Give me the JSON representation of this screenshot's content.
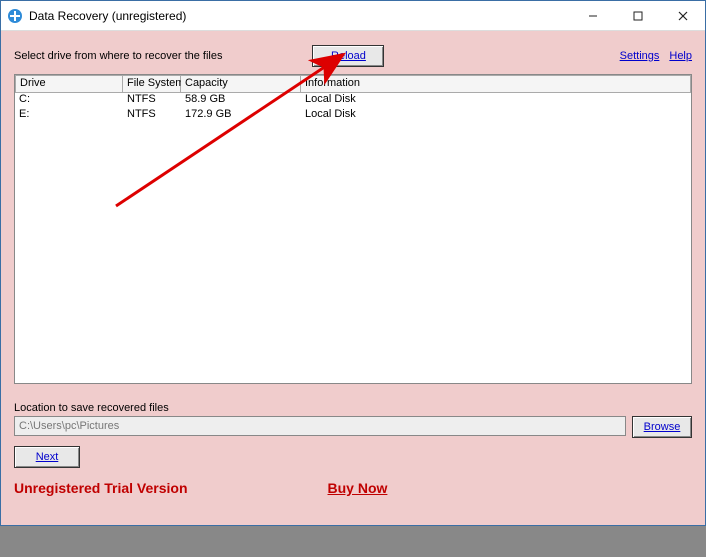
{
  "titlebar": {
    "title": "Data Recovery (unregistered)"
  },
  "top": {
    "instruction": "Select drive from where to recover the files",
    "reload_label": "Reload",
    "settings_label": "Settings",
    "help_label": "Help"
  },
  "table": {
    "headers": {
      "drive": "Drive",
      "fs": "File System",
      "capacity": "Capacity",
      "info": "Information"
    },
    "rows": [
      {
        "drive": "C:",
        "fs": "NTFS",
        "capacity": "58.9 GB",
        "info": "Local Disk"
      },
      {
        "drive": "E:",
        "fs": "NTFS",
        "capacity": "172.9 GB",
        "info": "Local Disk"
      }
    ]
  },
  "location": {
    "label": "Location to save recovered files",
    "value": "C:\\Users\\pc\\Pictures",
    "browse_label": "Browse"
  },
  "actions": {
    "next_label": "Next"
  },
  "footer": {
    "unregistered": "Unregistered Trial Version",
    "buy_now": "Buy Now"
  }
}
